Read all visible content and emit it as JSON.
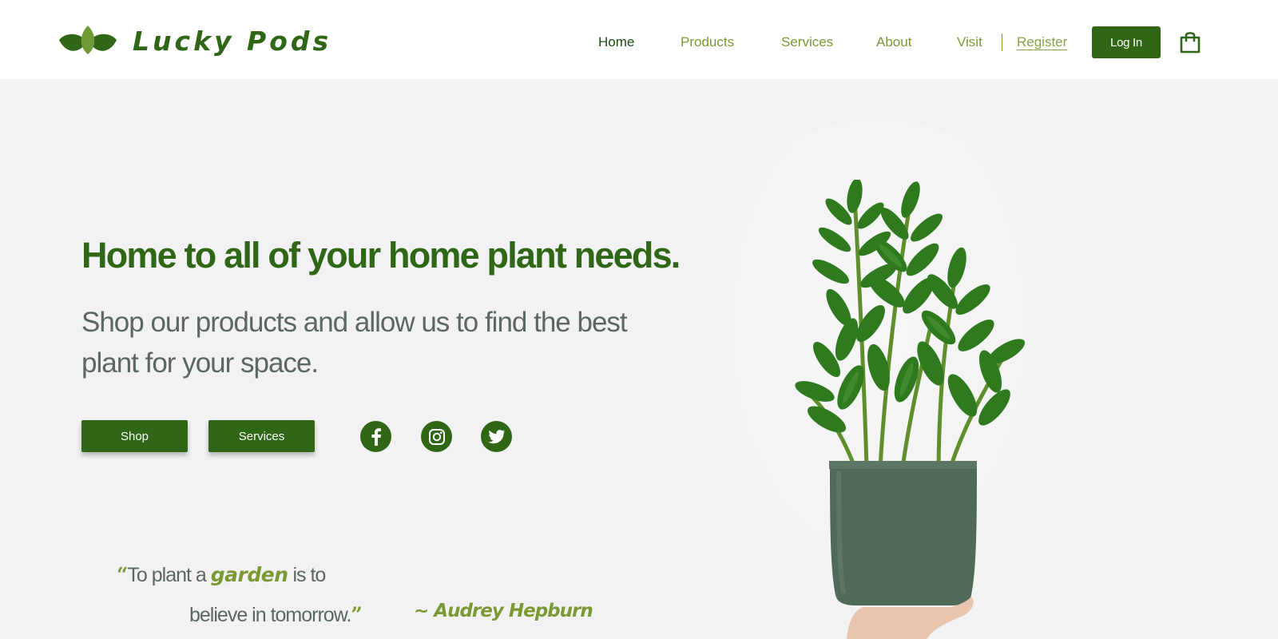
{
  "brand": {
    "name": "Lucky Pods",
    "color_primary": "#2f6716",
    "color_accent": "#7b9a33",
    "logo_icon": "leaves-logo-icon"
  },
  "nav": {
    "items": [
      {
        "label": "Home",
        "active": true
      },
      {
        "label": "Products",
        "active": false
      },
      {
        "label": "Services",
        "active": false
      },
      {
        "label": "About",
        "active": false
      },
      {
        "label": "Visit",
        "active": false
      }
    ],
    "register_label": "Register",
    "login_label": "Log In",
    "cart_icon": "shopping-bag-icon"
  },
  "hero": {
    "headline": "Home to all of your home plant needs.",
    "subhead": "Shop our products and allow us to find the best plant for your space.",
    "shop_label": "Shop",
    "services_label": "Services",
    "social_icons": [
      "facebook-icon",
      "instagram-icon",
      "twitter-icon"
    ],
    "image": "potted-zz-plant-image"
  },
  "quote": {
    "open_mark": "“",
    "part1": "To plant a",
    "emphasis": "garden",
    "part2": "is to",
    "line2": "believe in tomorrow.",
    "close_mark": "”",
    "author": "~ Audrey Hepburn"
  }
}
